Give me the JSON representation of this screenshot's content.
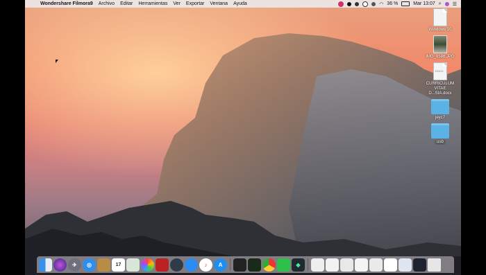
{
  "menubar": {
    "app_name": "Wondershare Filmora9",
    "menus": [
      "Archivo",
      "Editar",
      "Herramientas",
      "Ver",
      "Exportar",
      "Ventana",
      "Ayuda"
    ],
    "battery": "36 %",
    "clock": "Mar 13:07"
  },
  "desktop_icons": [
    {
      "label": "Windows 10",
      "icon": "document-icon"
    },
    {
      "label": "IMG_9586.JPG",
      "icon": "image-icon"
    },
    {
      "label": "CURRICULUM VITAE D...SIA.docx",
      "icon": "docx-icon"
    },
    {
      "label": "jeyc7",
      "icon": "folder-icon"
    },
    {
      "label": "usb",
      "icon": "folder-icon"
    }
  ],
  "docx_tag": "DOCX",
  "dock": {
    "calendar_day": "17",
    "apps": [
      "Finder",
      "Siri",
      "Launchpad",
      "Safari",
      "Notes",
      "Calendar",
      "Preview",
      "Photos",
      "PDF",
      "Chrome Canary",
      "Messages",
      "iTunes",
      "App Store",
      "Terminal",
      "Activity",
      "Chrome",
      "WeChat",
      "Filmora",
      "iTunes File",
      "Screenshot",
      "Screenshot",
      "Screenshot",
      "Screenshot",
      "Screenshot",
      "Screenshot",
      "Screenshot",
      "Trash"
    ]
  },
  "colors": {
    "folder": "#5ab3e4",
    "menubar_bg": "#ece8e8"
  }
}
